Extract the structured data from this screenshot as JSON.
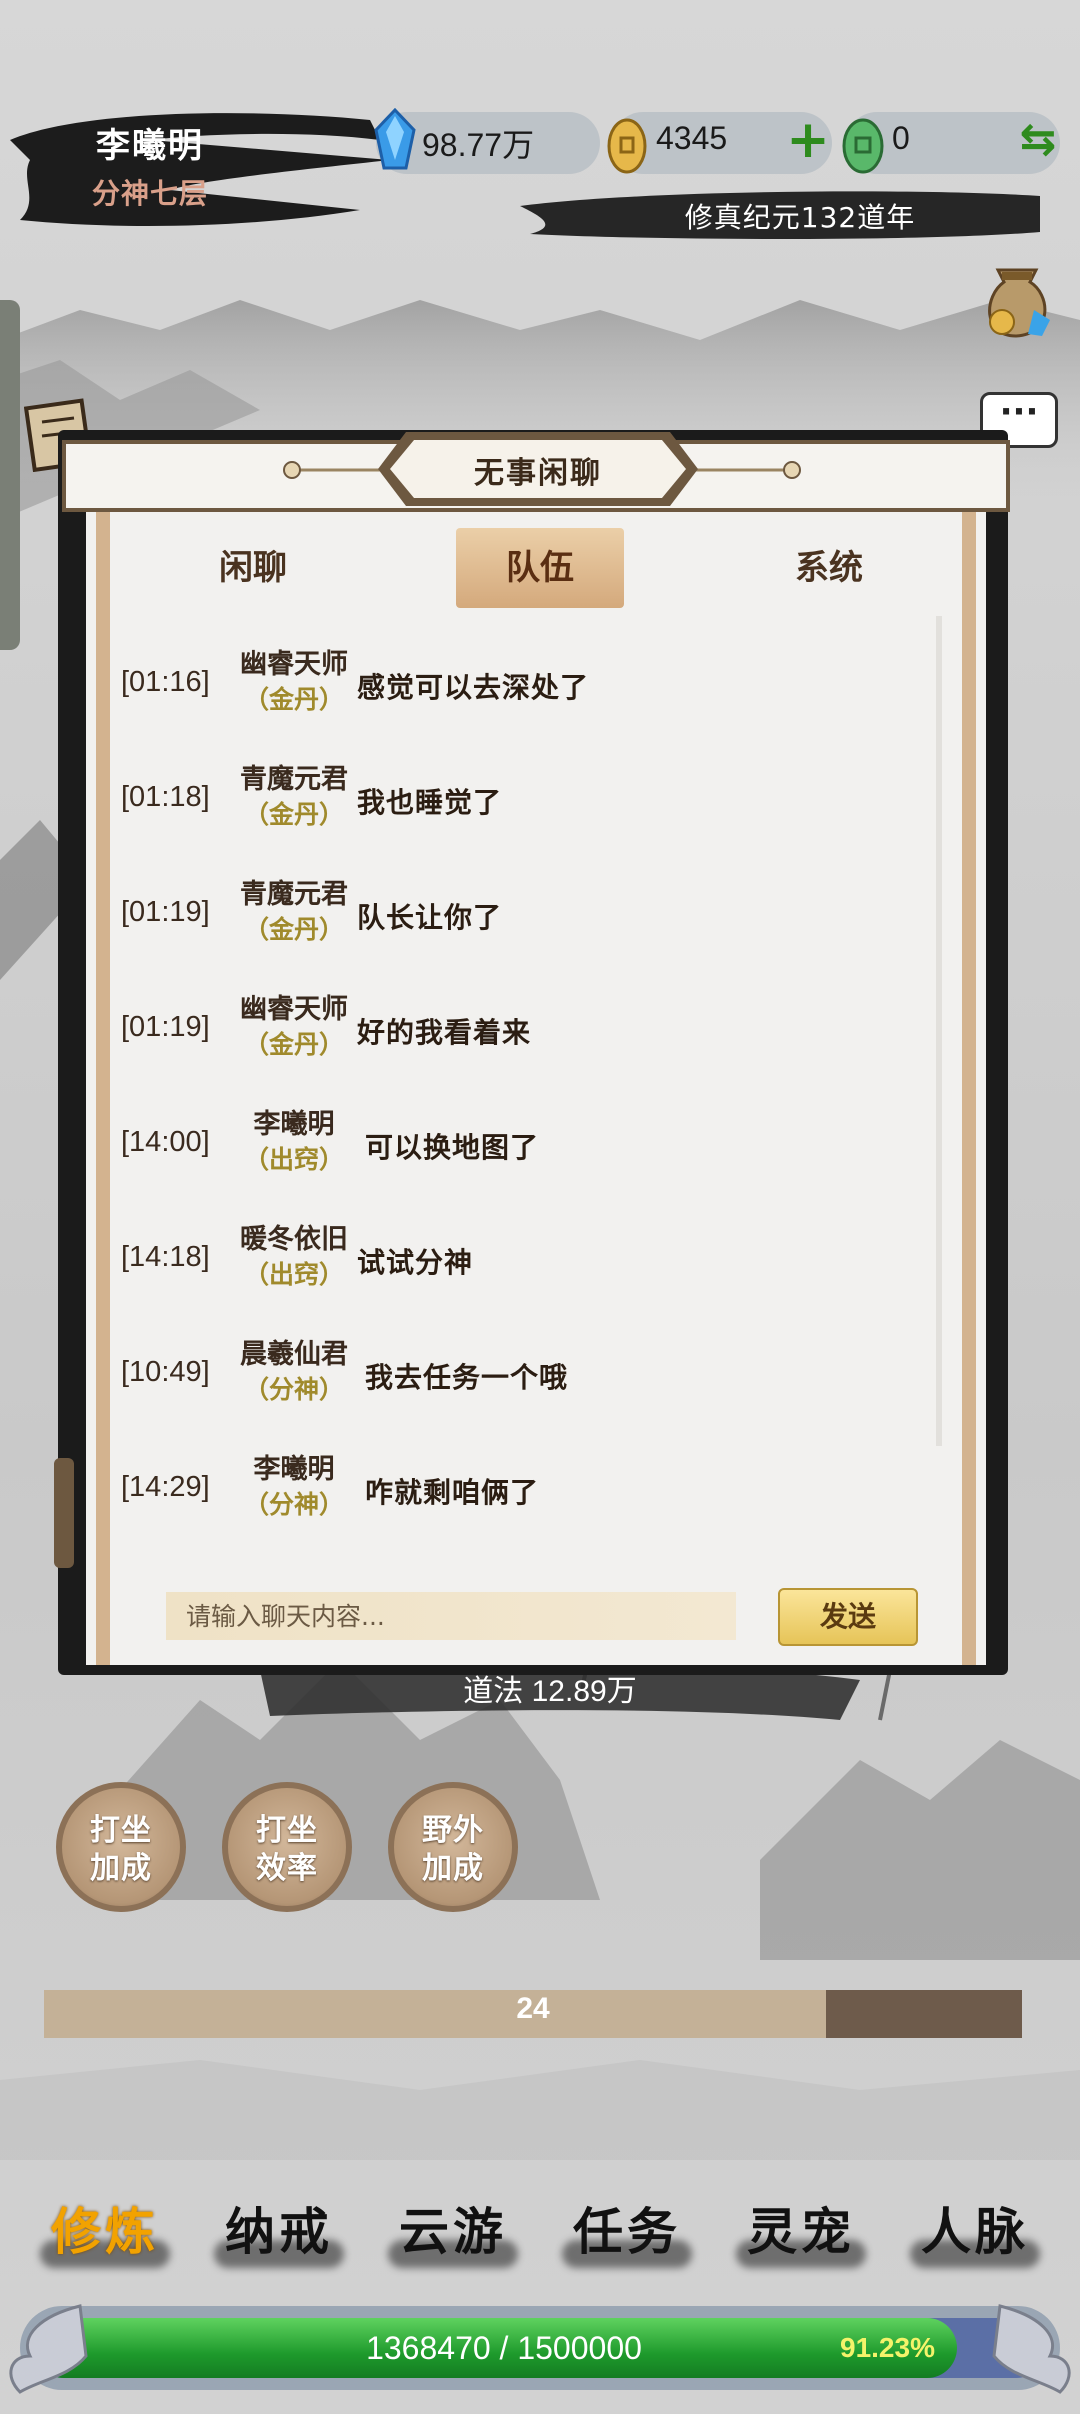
{
  "header": {
    "player_name": "李曦明",
    "realm": "分神七层",
    "resources": [
      {
        "icon": "blue-crystal-icon",
        "value": "98.77万"
      },
      {
        "icon": "gold-coin-icon",
        "value": "4345"
      },
      {
        "icon": "jade-coin-icon",
        "value": "0"
      }
    ],
    "add_symbol": "+",
    "swap_symbol": "⇆",
    "era": "修真纪元132道年"
  },
  "chat": {
    "title": "无事闲聊",
    "tabs": [
      {
        "label": "闲聊",
        "active": false
      },
      {
        "label": "队伍",
        "active": true
      },
      {
        "label": "系统",
        "active": false
      }
    ],
    "messages": [
      {
        "time": "[01:16]",
        "name": "幽睿天师",
        "realm": "（金丹）",
        "text": "感觉可以去深处了"
      },
      {
        "time": "[01:18]",
        "name": "青魔元君",
        "realm": "（金丹）",
        "text": "我也睡觉了"
      },
      {
        "time": "[01:19]",
        "name": "青魔元君",
        "realm": "（金丹）",
        "text": "队长让你了"
      },
      {
        "time": "[01:19]",
        "name": "幽睿天师",
        "realm": "（金丹）",
        "text": "好的我看着来"
      },
      {
        "time": "[14:00]",
        "name": "李曦明",
        "realm": "（出窍）",
        "text": "可以换地图了"
      },
      {
        "time": "[14:18]",
        "name": "暖冬依旧",
        "realm": "（出窍）",
        "text": "试试分神"
      },
      {
        "time": "[10:49]",
        "name": "晨羲仙君",
        "realm": "（分神）",
        "text": "我去任务一个哦"
      },
      {
        "time": "[14:29]",
        "name": "李曦明",
        "realm": "（分神）",
        "text": "咋就剩咱俩了"
      }
    ],
    "input_placeholder": "请输入聊天内容...",
    "send_label": "发送",
    "more_label": "···"
  },
  "daofa": "道法 12.89万",
  "buttons": [
    {
      "line1": "打坐",
      "line2": "加成"
    },
    {
      "line1": "打坐",
      "line2": "效率"
    },
    {
      "line1": "野外",
      "line2": "加成"
    }
  ],
  "progress": {
    "label": "24",
    "fraction": 0.8
  },
  "nav": [
    {
      "label": "修炼",
      "active": true
    },
    {
      "label": "纳戒",
      "active": false
    },
    {
      "label": "云游",
      "active": false
    },
    {
      "label": "任务",
      "active": false
    },
    {
      "label": "灵宠",
      "active": false
    },
    {
      "label": "人脉",
      "active": false
    }
  ],
  "exp": {
    "current": 1368470,
    "max": 1500000,
    "text": "1368470 / 1500000",
    "percent_text": "91.23%"
  },
  "colors": {
    "accent_gold": "#f2a200",
    "realm_gold": "#a08a2c",
    "exp_green": "#1e9a2c",
    "add_green": "#2e8b1e"
  }
}
